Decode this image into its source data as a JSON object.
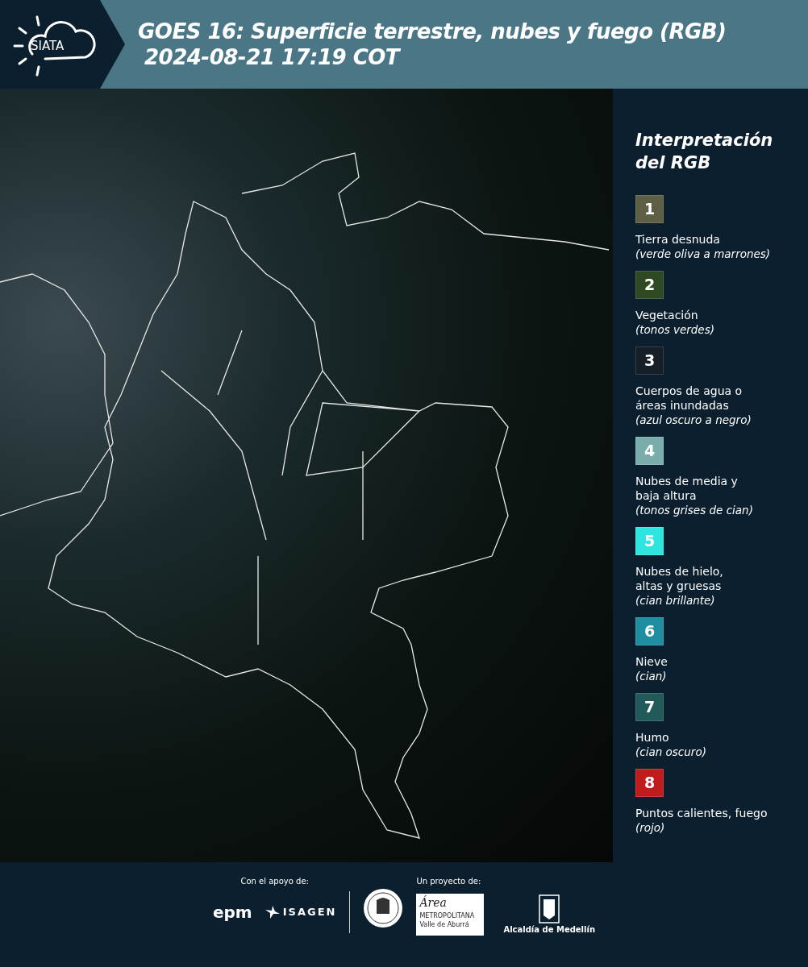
{
  "header": {
    "logo_text": "SIATA",
    "title": "GOES 16: Superficie terrestre, nubes y fuego (RGB)",
    "timestamp": "2024-08-21 17:19 COT"
  },
  "legend": {
    "title": "Interpretación del RGB",
    "items": [
      {
        "number": "1",
        "color": "#5f5f45",
        "label": "Tierra desnuda",
        "note": "(verde oliva a marrones)"
      },
      {
        "number": "2",
        "color": "#2f4a22",
        "label": "Vegetación",
        "note": "(tonos verdes)"
      },
      {
        "number": "3",
        "color": "#161e28",
        "label": [
          "Cuerpos de agua o",
          "áreas inundadas"
        ],
        "note": "(azul oscuro a negro)"
      },
      {
        "number": "4",
        "color": "#7aacac",
        "label": [
          "Nubes de media y",
          "baja altura"
        ],
        "note": "(tonos grises de cian)"
      },
      {
        "number": "5",
        "color": "#2ee5e0",
        "label": [
          "Nubes de hielo,",
          "altas y gruesas"
        ],
        "note": "(cian brillante)"
      },
      {
        "number": "6",
        "color": "#1f8ea0",
        "label": "Nieve",
        "note": "(cian)"
      },
      {
        "number": "7",
        "color": "#215a58",
        "label": "Humo",
        "note": "(cian oscuro)"
      },
      {
        "number": "8",
        "color": "#c01c1e",
        "label": "Puntos calientes, fuego",
        "note": "(rojo)"
      }
    ]
  },
  "footer": {
    "support_label": "Con el apoyo de:",
    "project_label": "Un proyecto de:",
    "epm": "epm",
    "isagen": "ISAGEN",
    "area": "Área",
    "area_sub1": "METROPOLITANA",
    "area_sub2": "Valle de Aburrá",
    "alcaldia": "Alcaldía de Medellín"
  }
}
